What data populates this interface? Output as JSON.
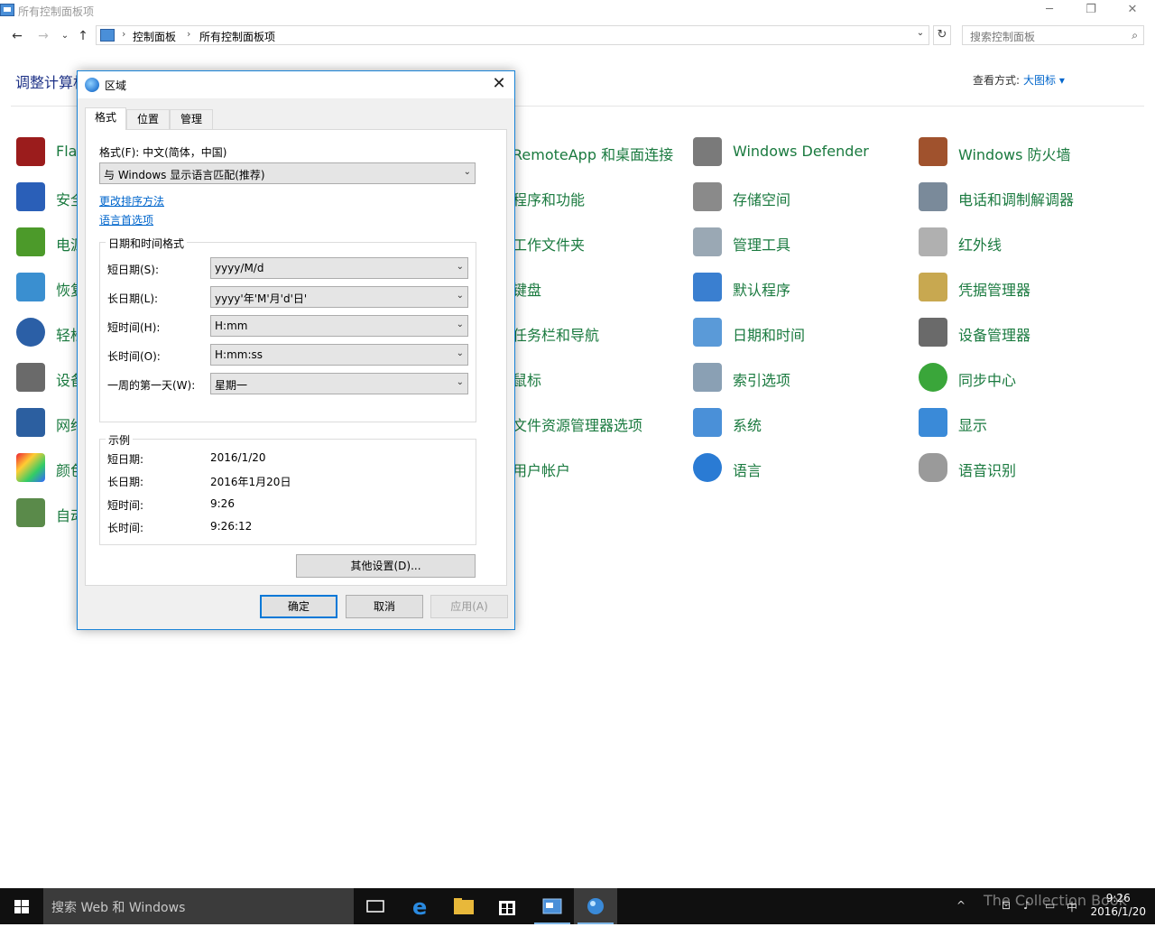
{
  "window": {
    "title": "所有控制面板项",
    "minimize": "─",
    "restore": "❐",
    "close": "✕"
  },
  "nav": {
    "back": "←",
    "forward": "→",
    "recent": "⌄",
    "up": "↑",
    "breadcrumbs": [
      "控制面板",
      "所有控制面板项"
    ],
    "separator": "›",
    "dropdown": "⌄",
    "refresh": "↻",
    "search_placeholder": "搜索控制面板",
    "search_icon": "⌕"
  },
  "content": {
    "heading": "调整计算机",
    "view_by_label": "查看方式:",
    "view_by_value": "大图标 ▾"
  },
  "items_col1": [
    "Fla",
    "安全",
    "电源",
    "恢复",
    "轻松",
    "设备",
    "网络",
    "颜色",
    "自动"
  ],
  "items_col2": [
    "RemoteApp 和桌面连接",
    "程序和功能",
    "工作文件夹",
    "键盘",
    "任务栏和导航",
    "鼠标",
    "文件资源管理器选项",
    "用户帐户"
  ],
  "items_col3": [
    "Windows Defender",
    "存储空间",
    "管理工具",
    "默认程序",
    "日期和时间",
    "索引选项",
    "系统",
    "语言"
  ],
  "items_col4": [
    "Windows 防火墙",
    "电话和调制解调器",
    "红外线",
    "凭据管理器",
    "设备管理器",
    "同步中心",
    "显示",
    "语音识别"
  ],
  "dialog": {
    "title": "区域",
    "close": "✕",
    "tabs": [
      "格式",
      "位置",
      "管理"
    ],
    "format_label": "格式(F): 中文(简体，中国)",
    "format_value": "与 Windows 显示语言匹配(推荐)",
    "link_sort": "更改排序方法",
    "link_lang": "语言首选项",
    "datetime_group": "日期和时间格式",
    "fields": [
      {
        "label": "短日期(S):",
        "value": "yyyy/M/d"
      },
      {
        "label": "长日期(L):",
        "value": "yyyy'年'M'月'd'日'"
      },
      {
        "label": "短时间(H):",
        "value": "H:mm"
      },
      {
        "label": "长时间(O):",
        "value": "H:mm:ss"
      },
      {
        "label": "一周的第一天(W):",
        "value": "星期一"
      }
    ],
    "example_group": "示例",
    "examples": [
      {
        "label": "短日期:",
        "value": "2016/1/20"
      },
      {
        "label": "长日期:",
        "value": "2016年1月20日"
      },
      {
        "label": "短时间:",
        "value": "9:26"
      },
      {
        "label": "长时间:",
        "value": "9:26:12"
      }
    ],
    "other_settings": "其他设置(D)...",
    "ok": "确定",
    "cancel": "取消",
    "apply": "应用(A)",
    "combo_arrow": "⌄"
  },
  "taskbar": {
    "search_placeholder": "搜索 Web 和 Windows",
    "tray_icons": [
      "^",
      "⊡",
      "♪",
      "▭",
      "中"
    ],
    "time": "9:26",
    "date": "2016/1/20",
    "watermark": "The Collection Book"
  },
  "colors": {
    "accent": "#0078d7",
    "link_green": "#1a7a3f",
    "heading_blue": "#1e3287",
    "taskbar": "#101010"
  }
}
